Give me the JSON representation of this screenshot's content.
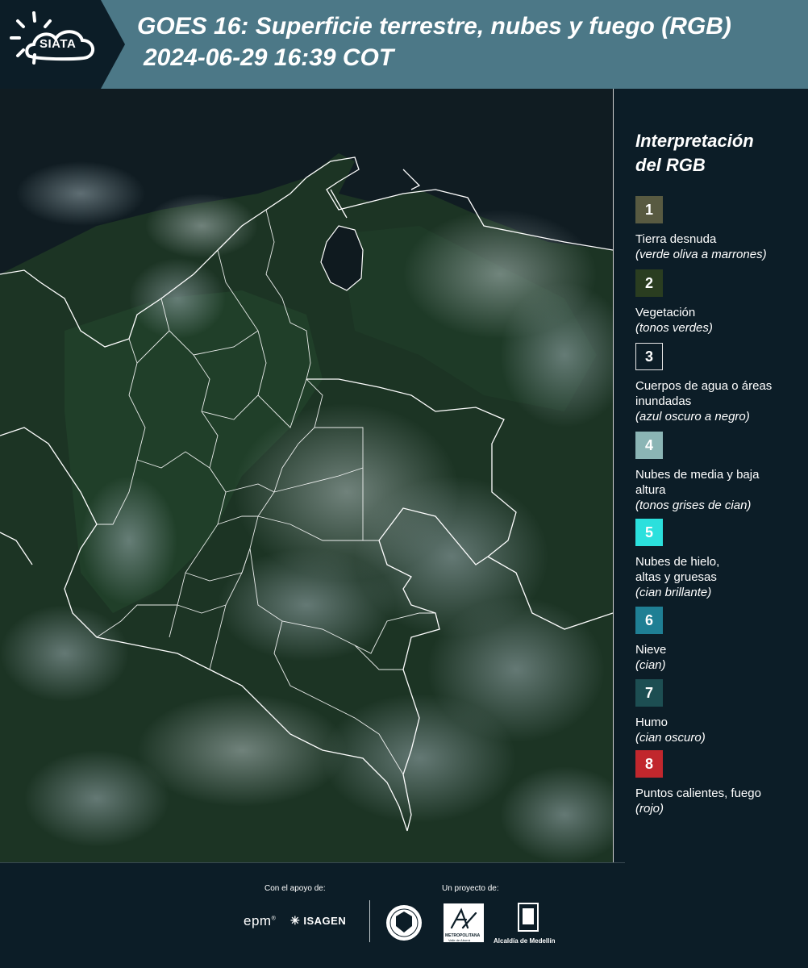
{
  "header": {
    "logo_text": "SIATA",
    "title": "GOES 16: Superficie terrestre, nubes y fuego (RGB)",
    "timestamp": "2024-06-29 16:39 COT"
  },
  "legend": {
    "title_line1": "Interpretación",
    "title_line2": "del RGB",
    "items": [
      {
        "number": "1",
        "color": "#585a41",
        "label": "Tierra desnuda",
        "sub": "(verde oliva a marrones)"
      },
      {
        "number": "2",
        "color": "#2a3d20",
        "label": "Vegetación",
        "sub": "(tonos verdes)"
      },
      {
        "number": "3",
        "color": "#0c1d27",
        "label": "Cuerpos de agua o áreas inundadas",
        "sub": "(azul oscuro a negro)"
      },
      {
        "number": "4",
        "color": "#8bb5b5",
        "label": "Nubes de media y baja altura",
        "sub": "(tonos grises de cian)"
      },
      {
        "number": "5",
        "color": "#2be0dd",
        "label": "Nubes de hielo, altas y gruesas",
        "sub": "(cian brillante)"
      },
      {
        "number": "6",
        "color": "#1f7f94",
        "label": "Nieve",
        "sub": "(cian)"
      },
      {
        "number": "7",
        "color": "#1d4e52",
        "label": "Humo",
        "sub": "(cian oscuro)"
      },
      {
        "number": "8",
        "color": "#c1272d",
        "label": "Puntos calientes, fuego",
        "sub": "(rojo)"
      }
    ]
  },
  "footer": {
    "support_label": "Con el apoyo de:",
    "project_label": "Un proyecto de:",
    "epm": "epm",
    "isagen": "ISAGEN",
    "area_metro_line1": "METROPOLITANA",
    "area_metro_line2": "Valle de Aburrá",
    "alcaldia": "Alcaldía de Medellín"
  }
}
